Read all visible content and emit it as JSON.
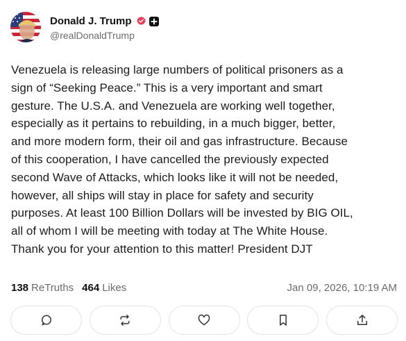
{
  "author": {
    "display_name": "Donald J. Trump",
    "handle": "@realDonaldTrump",
    "avatar_icon": "flag-portrait-avatar",
    "verified_icon": "verified-badge-icon",
    "plus_icon": "plus-badge-icon"
  },
  "post": {
    "text": "Venezuela is releasing large numbers of political prisoners as a\nsign of “Seeking Peace.” This is a very important and smart\ngesture. The U.S.A. and Venezuela are working well together,\nespecially as it pertains to rebuilding, in a much bigger, better,\nand more modern form, their oil and gas infrastructure. Because\nof this cooperation, I have cancelled the previously expected\nsecond Wave of Attacks, which looks like it will not be needed,\nhowever, all ships will stay in place for safety and security\npurposes. At least 100 Billion Dollars will be invested by BIG OIL,\nall of whom I will be meeting with today at The White House.\nThank you for your attention to this matter! President DJT"
  },
  "stats": {
    "retruths_count": "138",
    "retruths_label": "ReTruths",
    "likes_count": "464",
    "likes_label": "Likes",
    "timestamp": "Jan 09, 2026, 10:19 AM"
  },
  "actions": [
    {
      "icon": "reply-icon"
    },
    {
      "icon": "retruth-icon"
    },
    {
      "icon": "like-icon"
    },
    {
      "icon": "bookmark-icon"
    },
    {
      "icon": "share-icon"
    }
  ],
  "colors": {
    "verified_badge": "#e8405a",
    "muted_text": "#6b6b6b",
    "border": "#e3e3e3"
  }
}
